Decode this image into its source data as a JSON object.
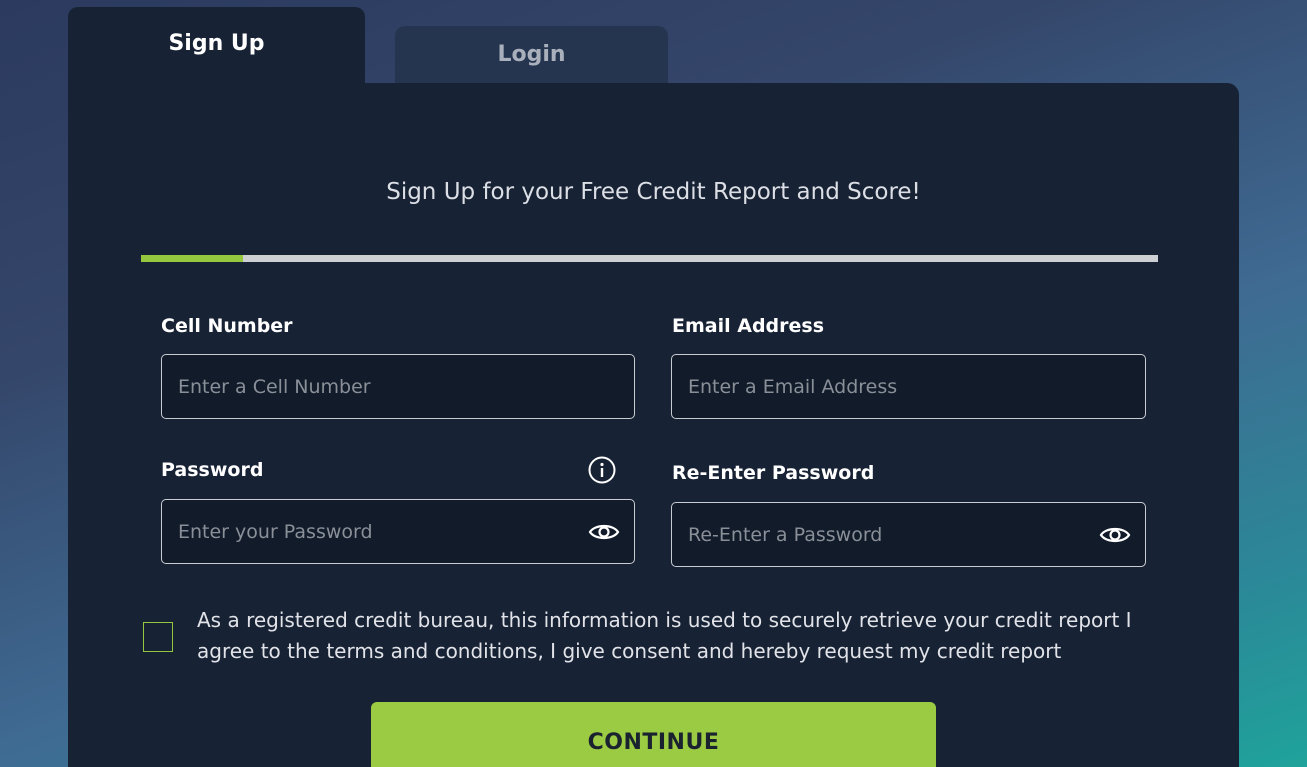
{
  "tabs": {
    "signup_label": "Sign Up",
    "login_label": "Login"
  },
  "form": {
    "subtitle": "Sign Up for your Free Credit Report and Score!",
    "progress": 0.1,
    "cell": {
      "label": "Cell Number",
      "placeholder": "Enter a Cell Number"
    },
    "email": {
      "label": "Email Address",
      "placeholder": "Enter a Email Address"
    },
    "password": {
      "label": "Password",
      "placeholder": "Enter your Password"
    },
    "reenter": {
      "label": "Re-Enter Password",
      "placeholder": "Re-Enter a Password"
    },
    "consent_text": "As a registered credit bureau, this information is used to securely retrieve your credit report I agree to the terms and conditions, I give consent and hereby request my credit report",
    "continue_label": "CONTINUE"
  },
  "icons": {
    "info": "info-icon",
    "eye": "eye-icon"
  },
  "colors": {
    "accent": "#95c83f",
    "card_bg": "#172234"
  }
}
